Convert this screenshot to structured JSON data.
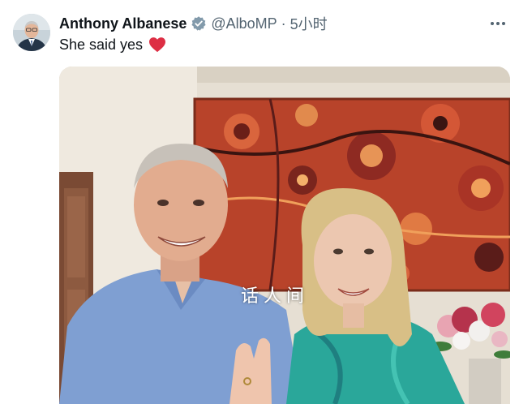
{
  "tweet": {
    "author": {
      "display_name": "Anthony Albanese",
      "handle": "@AlboMP",
      "avatar_icon": "avatar-photo",
      "verified_icon": "verified-badge-icon"
    },
    "separator": "·",
    "timestamp": "5小时",
    "more_icon": "more-horizontal-icon",
    "text": "She said yes",
    "emoji_icon": "red-heart-icon",
    "media": {
      "watermark_text": "话人间"
    }
  },
  "colors": {
    "text_primary": "#0f1419",
    "text_secondary": "#536471",
    "verified_grey": "#829aab",
    "heart_red": "#e0245e"
  }
}
